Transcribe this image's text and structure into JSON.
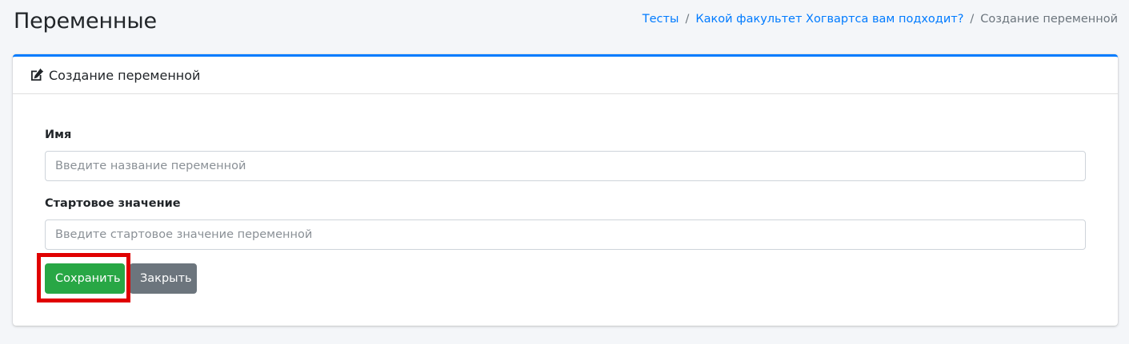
{
  "page": {
    "title": "Переменные"
  },
  "breadcrumb": {
    "items": [
      {
        "label": "Тесты",
        "link": true
      },
      {
        "label": "Какой факультет Хогвартса вам подходит?",
        "link": true
      },
      {
        "label": "Создание переменной",
        "link": false
      }
    ],
    "separator": "/"
  },
  "card": {
    "title": "Создание переменной",
    "icon": "edit-icon",
    "accent_color": "#007bff"
  },
  "form": {
    "name_label": "Имя",
    "name_placeholder": "Введите название переменной",
    "name_value": "",
    "start_label": "Стартовое значение",
    "start_placeholder": "Введите стартовое значение переменной",
    "start_value": ""
  },
  "actions": {
    "save_label": "Сохранить",
    "save_color": "#28a745",
    "close_label": "Закрыть",
    "close_color": "#6c757d"
  },
  "annotation": {
    "highlight_color": "#e00000",
    "highlighted": "save-button"
  }
}
